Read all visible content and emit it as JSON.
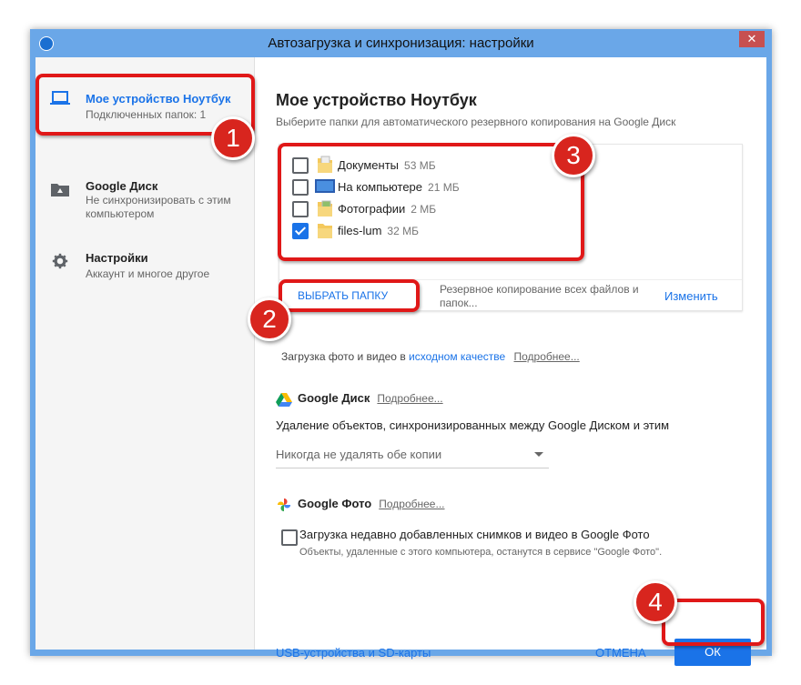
{
  "window": {
    "title": "Автозагрузка и синхронизация: настройки",
    "close_glyph": "✕"
  },
  "sidebar": {
    "items": [
      {
        "title": "Мое устройство Ноутбук",
        "subtitle": "Подключенных папок: 1",
        "icon": "laptop-icon",
        "selected": true
      },
      {
        "title": "Google Диск",
        "subtitle": "Не синхронизировать с этим компьютером",
        "icon": "drive-folder-icon"
      },
      {
        "title": "Настройки",
        "subtitle": "Аккаунт и многое другое",
        "icon": "gear-icon"
      }
    ]
  },
  "main": {
    "heading": "Мое устройство Ноутбук",
    "description": "Выберите папки для автоматического резервного копирования на Google Диск",
    "folders": [
      {
        "name": "Документы",
        "size": "53 МБ",
        "checked": false
      },
      {
        "name": "На компьютере",
        "size": "21 МБ",
        "checked": false
      },
      {
        "name": "Фотографии",
        "size": "2 МБ",
        "checked": false
      },
      {
        "name": "files-lum",
        "size": "32 МБ",
        "checked": true
      }
    ],
    "choose_folder_label": "ВЫБРАТЬ ПАПКУ",
    "backup_note": "Резервное копирование всех файлов и папок...",
    "change_label": "Изменить",
    "upload": {
      "prefix": "Загрузка фото и видео в ",
      "quality_link": "исходном качестве",
      "more_label": "Подробнее..."
    },
    "drive": {
      "title": "Google Диск",
      "more_label": "Подробнее...",
      "deletion_text": "Удаление объектов, синхронизированных между Google Диском и этим",
      "dropdown_value": "Никогда не удалять обе копии"
    },
    "photos": {
      "title": "Google Фото",
      "more_label": "Подробнее...",
      "checkbox_label": "Загрузка недавно добавленных снимков и видео в Google Фото",
      "note": "Объекты, удаленные с этого компьютера, останутся в сервисе \"Google Фото\".",
      "checked": false
    },
    "footer": {
      "usb_link": "USB-устройства и SD-карты",
      "cancel_label": "ОТМЕНА",
      "ok_label": "ОК"
    }
  },
  "annotations": {
    "badges": [
      "1",
      "2",
      "3",
      "4"
    ],
    "highlight_color": "#e01818"
  },
  "colors": {
    "accent": "#1a73e8",
    "window_frame": "#6aa7e8",
    "close_button": "#c75050"
  }
}
